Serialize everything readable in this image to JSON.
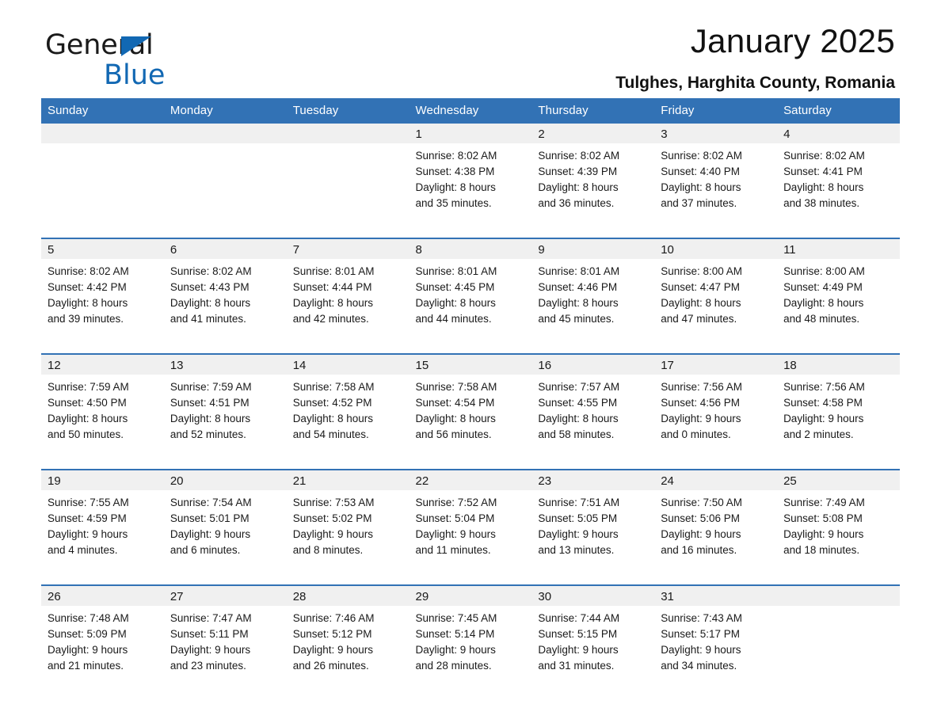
{
  "brand": {
    "name_part1": "General",
    "name_part2": "Blue",
    "triangle_color": "#1268b3",
    "text_color": "#1a1a1a"
  },
  "header": {
    "title": "January 2025",
    "subtitle": "Tulghes, Harghita County, Romania"
  },
  "colors": {
    "header_blue": "#3272b5",
    "row_divider_blue": "#3272b5",
    "daynum_band": "#f0f0f0",
    "cell_background": "#ffffff",
    "text": "#1a1a1a"
  },
  "calendar": {
    "columns": [
      "Sunday",
      "Monday",
      "Tuesday",
      "Wednesday",
      "Thursday",
      "Friday",
      "Saturday"
    ],
    "weeks": [
      [
        {
          "day": "",
          "lines": []
        },
        {
          "day": "",
          "lines": []
        },
        {
          "day": "",
          "lines": []
        },
        {
          "day": "1",
          "lines": [
            "Sunrise: 8:02 AM",
            "Sunset: 4:38 PM",
            "Daylight: 8 hours",
            "and 35 minutes."
          ]
        },
        {
          "day": "2",
          "lines": [
            "Sunrise: 8:02 AM",
            "Sunset: 4:39 PM",
            "Daylight: 8 hours",
            "and 36 minutes."
          ]
        },
        {
          "day": "3",
          "lines": [
            "Sunrise: 8:02 AM",
            "Sunset: 4:40 PM",
            "Daylight: 8 hours",
            "and 37 minutes."
          ]
        },
        {
          "day": "4",
          "lines": [
            "Sunrise: 8:02 AM",
            "Sunset: 4:41 PM",
            "Daylight: 8 hours",
            "and 38 minutes."
          ]
        }
      ],
      [
        {
          "day": "5",
          "lines": [
            "Sunrise: 8:02 AM",
            "Sunset: 4:42 PM",
            "Daylight: 8 hours",
            "and 39 minutes."
          ]
        },
        {
          "day": "6",
          "lines": [
            "Sunrise: 8:02 AM",
            "Sunset: 4:43 PM",
            "Daylight: 8 hours",
            "and 41 minutes."
          ]
        },
        {
          "day": "7",
          "lines": [
            "Sunrise: 8:01 AM",
            "Sunset: 4:44 PM",
            "Daylight: 8 hours",
            "and 42 minutes."
          ]
        },
        {
          "day": "8",
          "lines": [
            "Sunrise: 8:01 AM",
            "Sunset: 4:45 PM",
            "Daylight: 8 hours",
            "and 44 minutes."
          ]
        },
        {
          "day": "9",
          "lines": [
            "Sunrise: 8:01 AM",
            "Sunset: 4:46 PM",
            "Daylight: 8 hours",
            "and 45 minutes."
          ]
        },
        {
          "day": "10",
          "lines": [
            "Sunrise: 8:00 AM",
            "Sunset: 4:47 PM",
            "Daylight: 8 hours",
            "and 47 minutes."
          ]
        },
        {
          "day": "11",
          "lines": [
            "Sunrise: 8:00 AM",
            "Sunset: 4:49 PM",
            "Daylight: 8 hours",
            "and 48 minutes."
          ]
        }
      ],
      [
        {
          "day": "12",
          "lines": [
            "Sunrise: 7:59 AM",
            "Sunset: 4:50 PM",
            "Daylight: 8 hours",
            "and 50 minutes."
          ]
        },
        {
          "day": "13",
          "lines": [
            "Sunrise: 7:59 AM",
            "Sunset: 4:51 PM",
            "Daylight: 8 hours",
            "and 52 minutes."
          ]
        },
        {
          "day": "14",
          "lines": [
            "Sunrise: 7:58 AM",
            "Sunset: 4:52 PM",
            "Daylight: 8 hours",
            "and 54 minutes."
          ]
        },
        {
          "day": "15",
          "lines": [
            "Sunrise: 7:58 AM",
            "Sunset: 4:54 PM",
            "Daylight: 8 hours",
            "and 56 minutes."
          ]
        },
        {
          "day": "16",
          "lines": [
            "Sunrise: 7:57 AM",
            "Sunset: 4:55 PM",
            "Daylight: 8 hours",
            "and 58 minutes."
          ]
        },
        {
          "day": "17",
          "lines": [
            "Sunrise: 7:56 AM",
            "Sunset: 4:56 PM",
            "Daylight: 9 hours",
            "and 0 minutes."
          ]
        },
        {
          "day": "18",
          "lines": [
            "Sunrise: 7:56 AM",
            "Sunset: 4:58 PM",
            "Daylight: 9 hours",
            "and 2 minutes."
          ]
        }
      ],
      [
        {
          "day": "19",
          "lines": [
            "Sunrise: 7:55 AM",
            "Sunset: 4:59 PM",
            "Daylight: 9 hours",
            "and 4 minutes."
          ]
        },
        {
          "day": "20",
          "lines": [
            "Sunrise: 7:54 AM",
            "Sunset: 5:01 PM",
            "Daylight: 9 hours",
            "and 6 minutes."
          ]
        },
        {
          "day": "21",
          "lines": [
            "Sunrise: 7:53 AM",
            "Sunset: 5:02 PM",
            "Daylight: 9 hours",
            "and 8 minutes."
          ]
        },
        {
          "day": "22",
          "lines": [
            "Sunrise: 7:52 AM",
            "Sunset: 5:04 PM",
            "Daylight: 9 hours",
            "and 11 minutes."
          ]
        },
        {
          "day": "23",
          "lines": [
            "Sunrise: 7:51 AM",
            "Sunset: 5:05 PM",
            "Daylight: 9 hours",
            "and 13 minutes."
          ]
        },
        {
          "day": "24",
          "lines": [
            "Sunrise: 7:50 AM",
            "Sunset: 5:06 PM",
            "Daylight: 9 hours",
            "and 16 minutes."
          ]
        },
        {
          "day": "25",
          "lines": [
            "Sunrise: 7:49 AM",
            "Sunset: 5:08 PM",
            "Daylight: 9 hours",
            "and 18 minutes."
          ]
        }
      ],
      [
        {
          "day": "26",
          "lines": [
            "Sunrise: 7:48 AM",
            "Sunset: 5:09 PM",
            "Daylight: 9 hours",
            "and 21 minutes."
          ]
        },
        {
          "day": "27",
          "lines": [
            "Sunrise: 7:47 AM",
            "Sunset: 5:11 PM",
            "Daylight: 9 hours",
            "and 23 minutes."
          ]
        },
        {
          "day": "28",
          "lines": [
            "Sunrise: 7:46 AM",
            "Sunset: 5:12 PM",
            "Daylight: 9 hours",
            "and 26 minutes."
          ]
        },
        {
          "day": "29",
          "lines": [
            "Sunrise: 7:45 AM",
            "Sunset: 5:14 PM",
            "Daylight: 9 hours",
            "and 28 minutes."
          ]
        },
        {
          "day": "30",
          "lines": [
            "Sunrise: 7:44 AM",
            "Sunset: 5:15 PM",
            "Daylight: 9 hours",
            "and 31 minutes."
          ]
        },
        {
          "day": "31",
          "lines": [
            "Sunrise: 7:43 AM",
            "Sunset: 5:17 PM",
            "Daylight: 9 hours",
            "and 34 minutes."
          ]
        },
        {
          "day": "",
          "lines": []
        }
      ]
    ]
  }
}
